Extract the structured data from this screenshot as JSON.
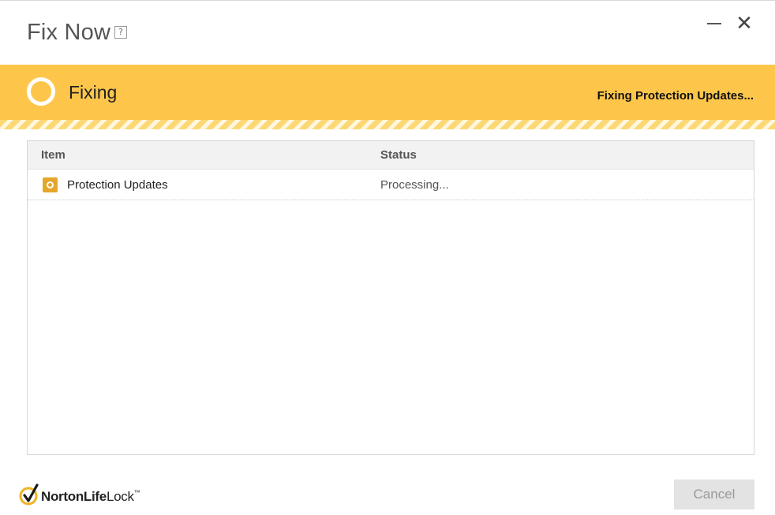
{
  "window": {
    "title": "Fix Now",
    "help_label": "?",
    "close_glyph": "✕"
  },
  "banner": {
    "title": "Fixing",
    "status": "Fixing Protection Updates...",
    "color": "#fdc64a"
  },
  "table": {
    "columns": [
      "Item",
      "Status"
    ],
    "rows": [
      {
        "item": "Protection Updates",
        "status": "Processing...",
        "icon": "in-progress-icon"
      }
    ]
  },
  "footer": {
    "logo_text_bold": "NortonLife",
    "logo_text_regular": "Lock",
    "logo_tm": "™",
    "cancel_label": "Cancel"
  }
}
